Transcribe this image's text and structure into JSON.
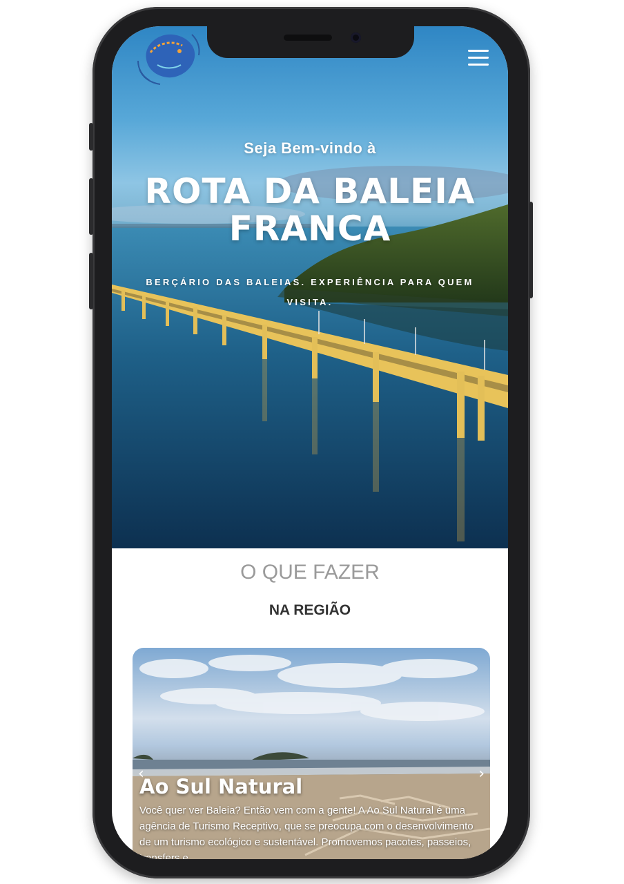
{
  "header": {
    "logo_icon": "whale-logo-icon",
    "menu_icon": "hamburger-menu-icon"
  },
  "hero": {
    "welcome": "Seja Bem-vindo à",
    "title_line1": "ROTA DA BALEIA",
    "title_line2": "FRANCA",
    "subtitle": "BERÇÁRIO DAS BALEIAS. EXPERIÊNCIA PARA QUEM VISITA."
  },
  "section": {
    "title": "O QUE FAZER",
    "subtitle": "NA REGIÃO"
  },
  "card": {
    "title": "Ao Sul Natural",
    "text": "Você quer ver Baleia? Então vem com a gente! A Ao Sul Natural é uma agência de Turismo Receptivo, que se preocupa com o desenvolvimento de um turismo ecológico e sustentável. Promovemos pacotes, passeios, transfers e",
    "prev_icon": "chevron-left-icon",
    "next_icon": "chevron-right-icon",
    "prev_glyph": "‹",
    "next_glyph": "›"
  },
  "colors": {
    "phone_frame": "#1d1d1f",
    "sky": "#2f86c4",
    "bridge": "#e8c35a"
  }
}
